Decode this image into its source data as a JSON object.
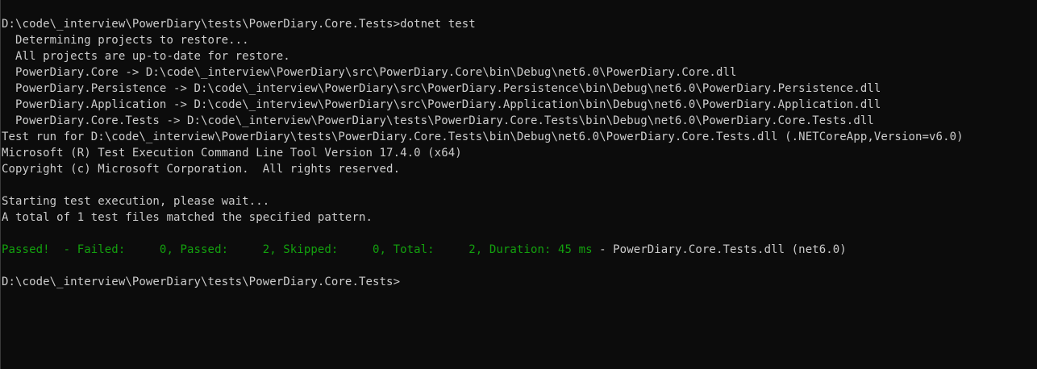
{
  "terminal": {
    "prompt_command": "D:\\code\\_interview\\PowerDiary\\tests\\PowerDiary.Core.Tests>dotnet test",
    "restore_1": "  Determining projects to restore...",
    "restore_2": "  All projects are up-to-date for restore.",
    "build_core": "  PowerDiary.Core -> D:\\code\\_interview\\PowerDiary\\src\\PowerDiary.Core\\bin\\Debug\\net6.0\\PowerDiary.Core.dll",
    "build_persistence": "  PowerDiary.Persistence -> D:\\code\\_interview\\PowerDiary\\src\\PowerDiary.Persistence\\bin\\Debug\\net6.0\\PowerDiary.Persistence.dll",
    "build_application": "  PowerDiary.Application -> D:\\code\\_interview\\PowerDiary\\src\\PowerDiary.Application\\bin\\Debug\\net6.0\\PowerDiary.Application.dll",
    "build_tests": "  PowerDiary.Core.Tests -> D:\\code\\_interview\\PowerDiary\\tests\\PowerDiary.Core.Tests\\bin\\Debug\\net6.0\\PowerDiary.Core.Tests.dll",
    "test_run": "Test run for D:\\code\\_interview\\PowerDiary\\tests\\PowerDiary.Core.Tests\\bin\\Debug\\net6.0\\PowerDiary.Core.Tests.dll (.NETCoreApp,Version=v6.0)",
    "tool_version": "Microsoft (R) Test Execution Command Line Tool Version 17.4.0 (x64)",
    "copyright": "Copyright (c) Microsoft Corporation.  All rights reserved.",
    "starting": "Starting test execution, please wait...",
    "matched": "A total of 1 test files matched the specified pattern.",
    "result_summary": "Passed!  - Failed:     0, Passed:     2, Skipped:     0, Total:     2, Duration: 45 ms",
    "result_suffix": " - PowerDiary.Core.Tests.dll (net6.0)",
    "final_prompt": "D:\\code\\_interview\\PowerDiary\\tests\\PowerDiary.Core.Tests>"
  },
  "colors": {
    "background": "#0c0c0c",
    "text": "#cccccc",
    "success": "#13a10e"
  }
}
